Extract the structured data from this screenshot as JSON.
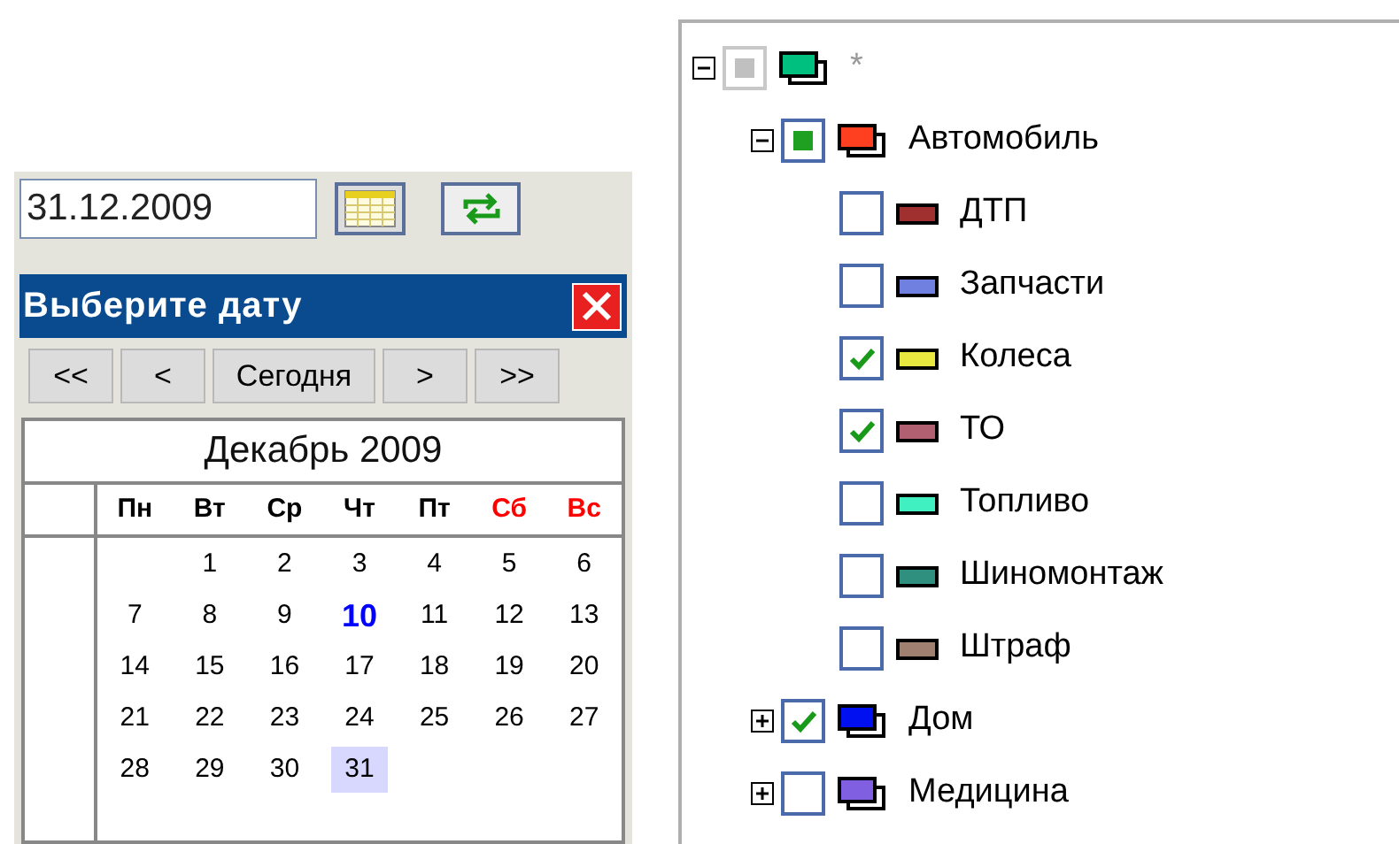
{
  "date_field": {
    "value": "31.12.2009"
  },
  "picker": {
    "title": "Выберите дату",
    "nav": [
      "<<",
      "<",
      "Сегодня",
      ">",
      ">>"
    ],
    "month": "Декабрь 2009",
    "weekdays": [
      {
        "label": "Пн",
        "weekend": false
      },
      {
        "label": "Вт",
        "weekend": false
      },
      {
        "label": "Ср",
        "weekend": false
      },
      {
        "label": "Чт",
        "weekend": false
      },
      {
        "label": "Пт",
        "weekend": false
      },
      {
        "label": "Сб",
        "weekend": true
      },
      {
        "label": "Вс",
        "weekend": true
      }
    ],
    "weeks": [
      [
        {
          "day": "1",
          "today": false,
          "selected": false
        },
        {
          "day": "2",
          "today": false,
          "selected": false
        },
        {
          "day": "3",
          "today": false,
          "selected": false
        },
        {
          "day": "4",
          "today": false,
          "selected": false
        },
        {
          "day": "5",
          "today": false,
          "selected": false
        },
        {
          "day": "6",
          "today": false,
          "selected": false
        }
      ],
      [
        {
          "day": "7",
          "today": false,
          "selected": false
        },
        {
          "day": "8",
          "today": false,
          "selected": false
        },
        {
          "day": "9",
          "today": false,
          "selected": false
        },
        {
          "day": "10",
          "today": true,
          "selected": false
        },
        {
          "day": "11",
          "today": false,
          "selected": false
        },
        {
          "day": "12",
          "today": false,
          "selected": false
        },
        {
          "day": "13",
          "today": false,
          "selected": false
        }
      ],
      [
        {
          "day": "14",
          "today": false,
          "selected": false
        },
        {
          "day": "15",
          "today": false,
          "selected": false
        },
        {
          "day": "16",
          "today": false,
          "selected": false
        },
        {
          "day": "17",
          "today": false,
          "selected": false
        },
        {
          "day": "18",
          "today": false,
          "selected": false
        },
        {
          "day": "19",
          "today": false,
          "selected": false
        },
        {
          "day": "20",
          "today": false,
          "selected": false
        }
      ],
      [
        {
          "day": "21",
          "today": false,
          "selected": false
        },
        {
          "day": "22",
          "today": false,
          "selected": false
        },
        {
          "day": "23",
          "today": false,
          "selected": false
        },
        {
          "day": "24",
          "today": false,
          "selected": false
        },
        {
          "day": "25",
          "today": false,
          "selected": false
        },
        {
          "day": "26",
          "today": false,
          "selected": false
        },
        {
          "day": "27",
          "today": false,
          "selected": false
        }
      ],
      [
        {
          "day": "28",
          "today": false,
          "selected": false
        },
        {
          "day": "29",
          "today": false,
          "selected": false
        },
        {
          "day": "30",
          "today": false,
          "selected": false
        },
        {
          "day": "31",
          "today": false,
          "selected": true
        }
      ]
    ]
  },
  "tree": [
    {
      "label": "*",
      "kind": "group",
      "color": "#00c080",
      "expanded": true,
      "checked": true,
      "partial": true,
      "disabled": true,
      "children": [
        {
          "label": "Автомобиль",
          "kind": "group",
          "color": "#ff4020",
          "expanded": true,
          "checked": true,
          "partial": true,
          "disabled": false,
          "children": [
            {
              "label": "ДТП",
              "kind": "category",
              "color": "#a03030",
              "checked": false,
              "partial": false,
              "disabled": false
            },
            {
              "label": "Запчасти",
              "kind": "category",
              "color": "#7080e0",
              "checked": false,
              "partial": false,
              "disabled": false
            },
            {
              "label": "Колеса",
              "kind": "category",
              "color": "#e8e840",
              "checked": true,
              "partial": false,
              "disabled": false
            },
            {
              "label": "ТО",
              "kind": "category",
              "color": "#b06070",
              "checked": true,
              "partial": false,
              "disabled": false
            },
            {
              "label": "Топливо",
              "kind": "category",
              "color": "#40f0c0",
              "checked": false,
              "partial": false,
              "disabled": false
            },
            {
              "label": "Шиномонтаж",
              "kind": "category",
              "color": "#309080",
              "checked": false,
              "partial": false,
              "disabled": false
            },
            {
              "label": "Штраф",
              "kind": "category",
              "color": "#a08070",
              "checked": false,
              "partial": false,
              "disabled": false
            }
          ]
        },
        {
          "label": "Дом",
          "kind": "group",
          "color": "#0010f0",
          "expanded": false,
          "checked": true,
          "partial": false,
          "disabled": false
        },
        {
          "label": "Медицина",
          "kind": "group",
          "color": "#8060e0",
          "expanded": false,
          "checked": false,
          "partial": false,
          "disabled": false
        }
      ]
    }
  ]
}
